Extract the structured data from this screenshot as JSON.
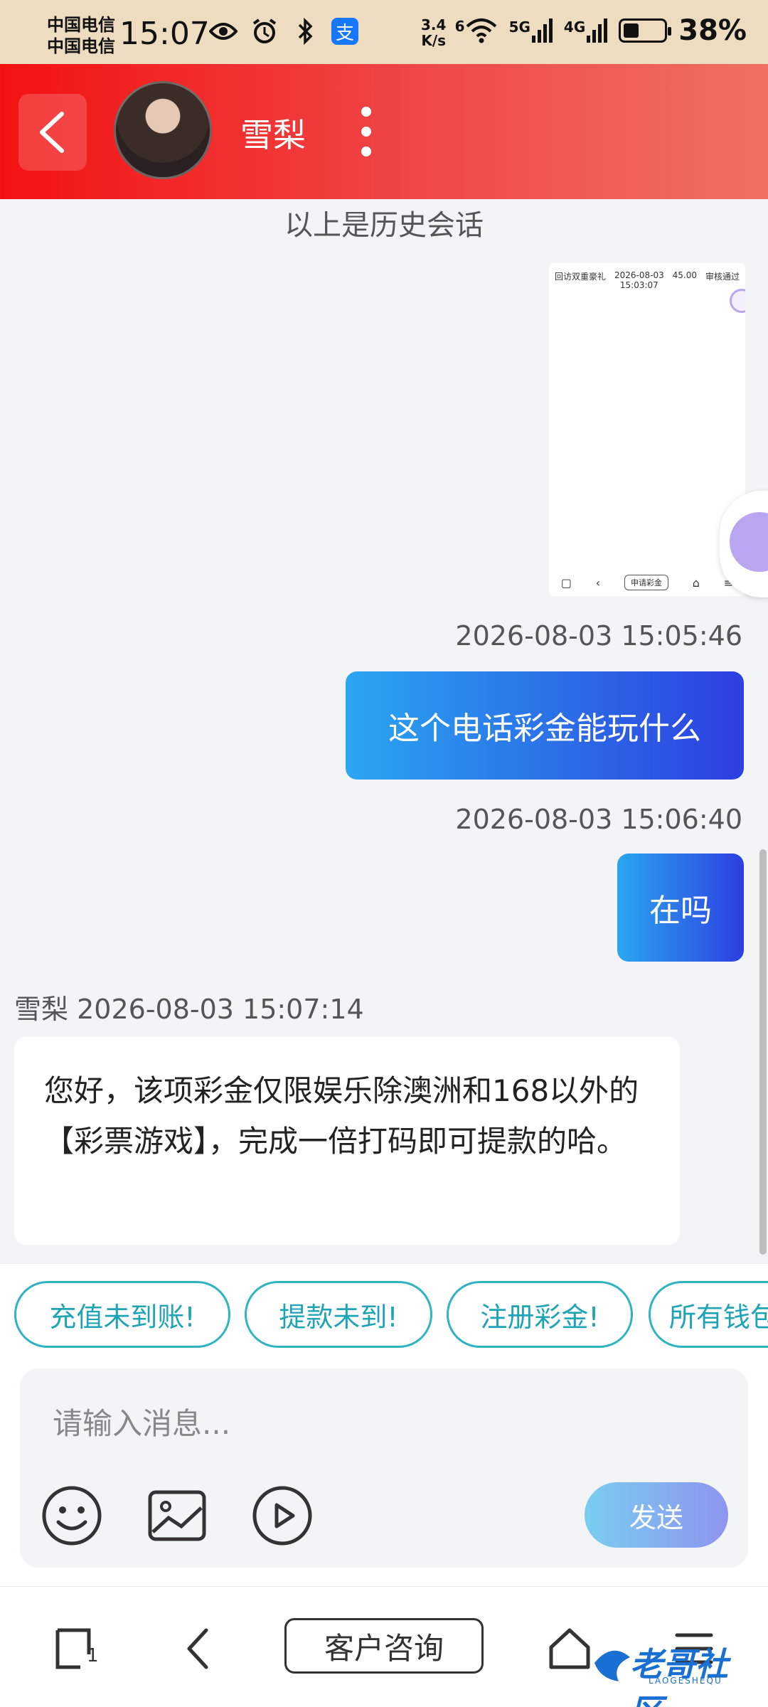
{
  "status_bar": {
    "carrier_1": "中国电信",
    "carrier_2": "中国电信",
    "time": "15:07",
    "speed_value": "3.4",
    "speed_unit": "K/s",
    "wifi_label": "6",
    "signal_1": "5G",
    "signal_2": "4G",
    "battery_percent": 38,
    "battery_text": "38%"
  },
  "header": {
    "contact_name": "雪梨"
  },
  "chat": {
    "history_note": "以上是历史会话",
    "thumbnail": {
      "row_label": "回访双重豪礼",
      "row_date": "2026-08-03",
      "row_time": "15:03:07",
      "row_amount": "45.00",
      "row_status": "审核通过",
      "nav_button": "申请彩金"
    },
    "messages": [
      {
        "direction": "out",
        "timestamp": "2026-08-03 15:05:46",
        "text": "这个电话彩金能玩什么"
      },
      {
        "direction": "out",
        "timestamp": "2026-08-03 15:06:40",
        "text": "在吗"
      },
      {
        "direction": "in",
        "sender": "雪梨",
        "timestamp": "2026-08-03 15:07:14",
        "text": "您好，该项彩金仅限娱乐除澳洲和168以外的【彩票游戏】，完成一倍打码即可提款的哈。"
      }
    ]
  },
  "quick_replies": [
    "充值未到账!",
    "提款未到!",
    "注册彩金!",
    "所有钱包"
  ],
  "composer": {
    "placeholder": "请输入消息...",
    "send_label": "发送"
  },
  "bottom_nav": {
    "tab_count": "1",
    "center_label": "客户咨询"
  },
  "watermark": {
    "text": "老哥社区",
    "sub": "LAOGESHEQU"
  },
  "colors": {
    "header_start": "#f31212",
    "header_end": "#ef7060",
    "bubble_start": "#2aa6f0",
    "bubble_end": "#2d3fe0",
    "chip_border": "#2fb3c0"
  }
}
